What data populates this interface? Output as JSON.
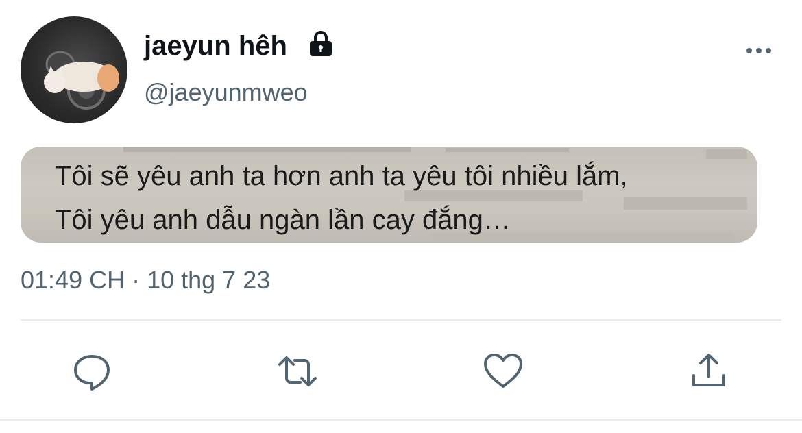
{
  "user": {
    "display_name": "jaeyun hêh",
    "handle": "@jaeyunmweo",
    "protected_icon": "lock-icon",
    "avatar": "cat-on-dumbbell-photo"
  },
  "tweet": {
    "image_text_line1": "Tôi sẽ yêu anh ta hơn anh ta yêu tôi nhiều lắm,",
    "image_text_line2": "Tôi yêu anh dẫu ngàn lần cay đắng…",
    "timestamp": "01:49 CH · 10 thg 7 23"
  },
  "actions": {
    "reply_icon": "reply-icon",
    "retweet_icon": "retweet-icon",
    "like_icon": "heart-icon",
    "share_icon": "share-icon",
    "more_icon": "more-options-icon"
  },
  "colors": {
    "primary_text": "#0f1419",
    "secondary_text": "#536471",
    "divider": "#e6ecf0",
    "icon": "#536471"
  }
}
